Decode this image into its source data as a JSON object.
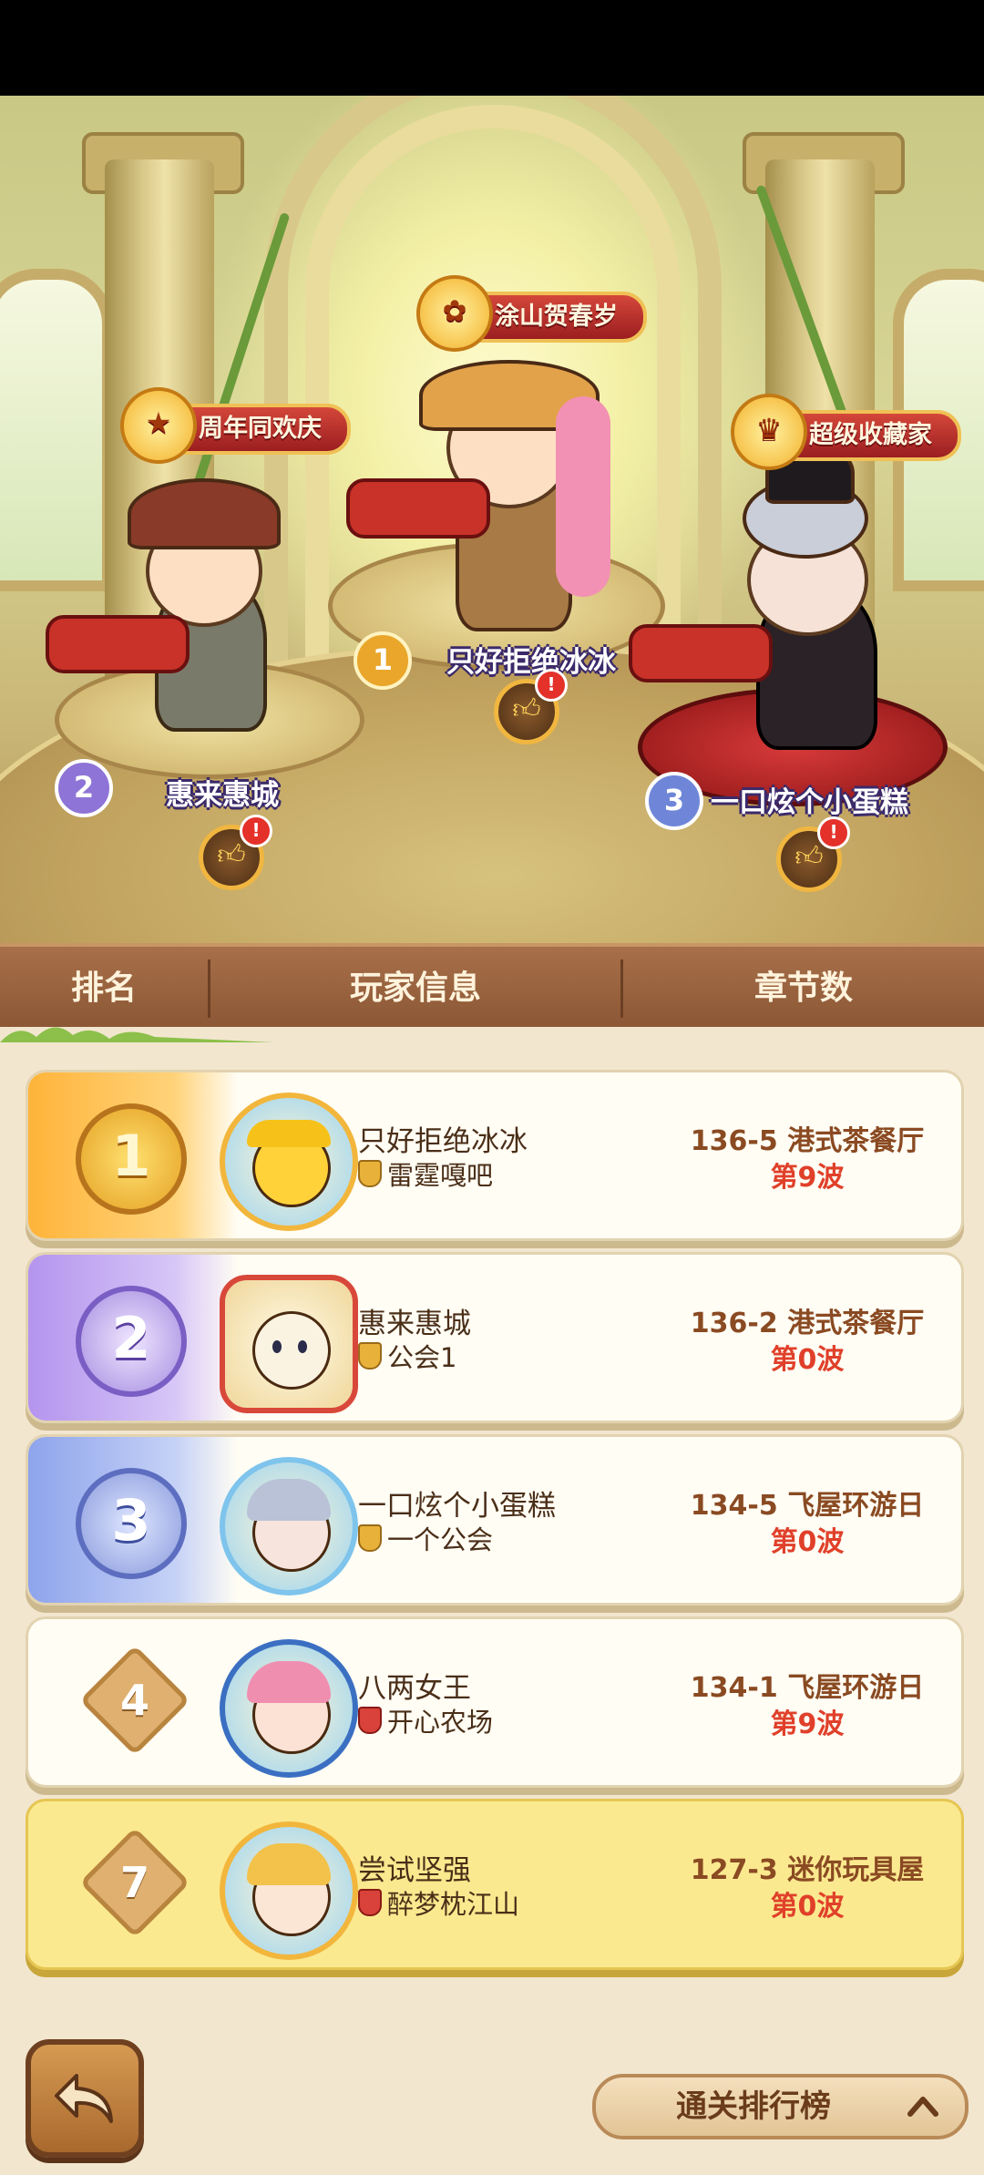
{
  "podium": [
    {
      "rank": "1",
      "name": "只好拒绝冰冰",
      "title": "涂山贺春岁"
    },
    {
      "rank": "2",
      "name": "惠来惠城",
      "title": "周年同欢庆"
    },
    {
      "rank": "3",
      "name": "一口炫个小蛋糕",
      "title": "超级收藏家"
    }
  ],
  "like_icon": "thumbs-up-icon",
  "header": {
    "rank": "排名",
    "player": "玩家信息",
    "chapter": "章节数"
  },
  "rows": [
    {
      "rank": "1",
      "name": "只好拒绝冰冰",
      "guild": "雷霆嘎吧",
      "chapter": "136-5 港式茶餐厅",
      "wave": "第9波"
    },
    {
      "rank": "2",
      "name": "惠来惠城",
      "guild": "公会1",
      "chapter": "136-2 港式茶餐厅",
      "wave": "第0波"
    },
    {
      "rank": "3",
      "name": "一口炫个小蛋糕",
      "guild": "一个公会",
      "chapter": "134-5 飞屋环游日",
      "wave": "第0波"
    },
    {
      "rank": "4",
      "name": "八两女王",
      "guild": "开心农场",
      "chapter": "134-1 飞屋环游日",
      "wave": "第9波"
    },
    {
      "rank": "7",
      "name": "尝试坚强",
      "guild": "醉梦枕江山",
      "chapter": "127-3 迷你玩具屋",
      "wave": "第0波"
    }
  ],
  "bottom": {
    "tab_label": "通关排行榜",
    "back_icon": "back-arrow-icon",
    "tab_icon": "chevron-up-icon"
  },
  "colors": {
    "gold": "#f2b63c",
    "silver_purple": "#8e74d6",
    "bronze_blue": "#6f86d8",
    "self_highlight": "#fbe98f"
  }
}
